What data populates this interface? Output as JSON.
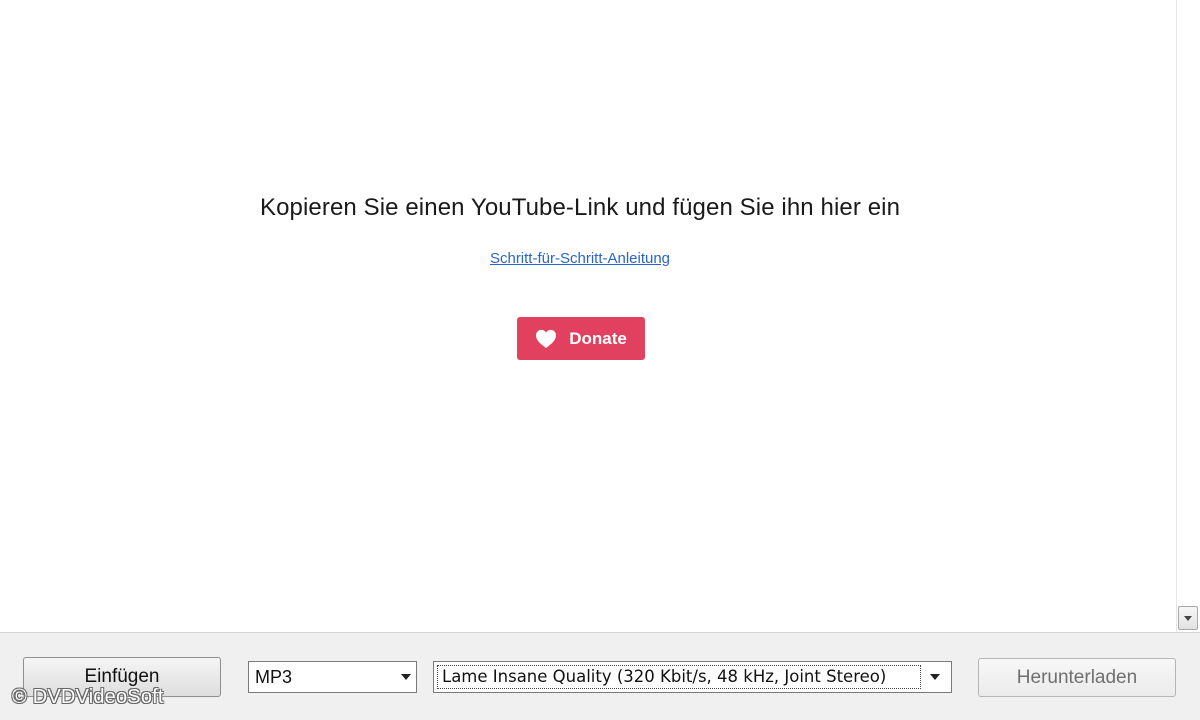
{
  "main": {
    "headline": "Kopieren Sie einen YouTube-Link und fügen Sie ihn hier ein",
    "guide_link": "Schritt-für-Schritt-Anleitung",
    "donate_label": "Donate"
  },
  "toolbar": {
    "paste_label": "Einfügen",
    "format_selected": "MP3",
    "quality_selected": "Lame Insane Quality (320 Kbit/s, 48 kHz, Joint Stereo)",
    "download_label": "Herunterladen"
  },
  "watermark": "© DVDVideoSoft",
  "icons": {
    "donate": "heart-icon",
    "dropdown": "chevron-down-icon",
    "scroll_down": "scroll-down-arrow-icon"
  },
  "colors": {
    "donate_bg": "#e2405f",
    "link": "#2a66c9",
    "toolbar_bg": "#f0f0f0"
  }
}
